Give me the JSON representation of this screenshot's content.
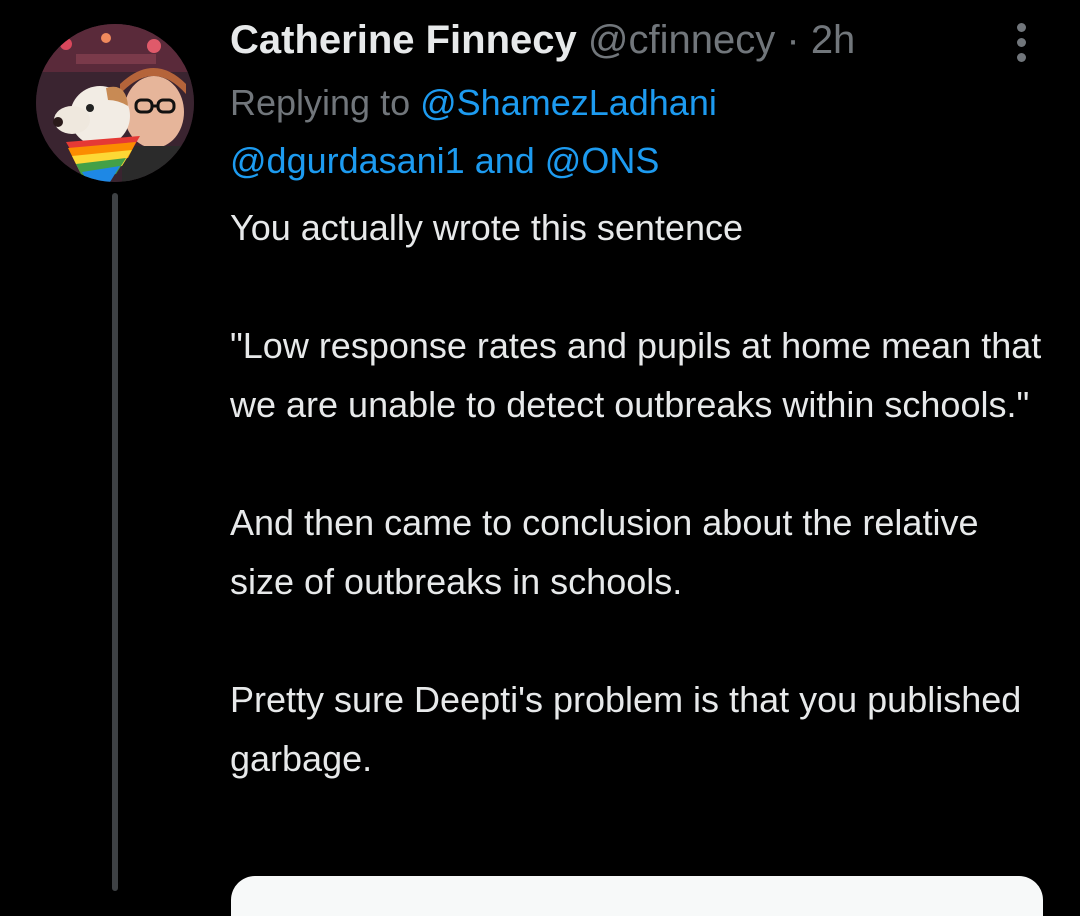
{
  "tweet": {
    "display_name": "Catherine Finnecy",
    "handle": "@cfinnecy",
    "separator": "·",
    "time": "2h",
    "more_icon": "more-vertical-icon",
    "replying_prefix": "Replying to ",
    "mention_1": "@ShamezLadhani",
    "mention_2": "@dgurdasani1",
    "mention_joiner": " and ",
    "mention_3": "@ONS",
    "paragraphs": [
      "You actually wrote this sentence",
      "\"Low response rates and pupils at home mean that we are unable to detect outbreaks within schools.\"",
      "And then came to conclusion about the relative size of outbreaks in schools.",
      "Pretty sure Deepti's problem is that you published garbage."
    ]
  },
  "colors": {
    "background": "#000000",
    "primary_text": "#e7e9ea",
    "secondary_text": "#71767b",
    "link": "#1d9bf0",
    "thread_line": "#3e4144"
  }
}
